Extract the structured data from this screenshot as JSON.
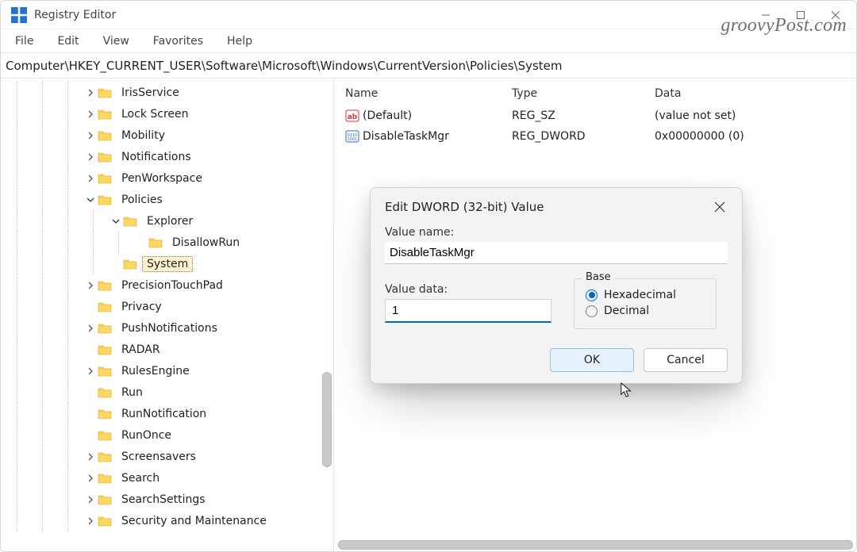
{
  "window": {
    "title": "Registry Editor"
  },
  "watermark": "groovyPost.com",
  "menu": [
    "File",
    "Edit",
    "View",
    "Favorites",
    "Help"
  ],
  "address": "Computer\\HKEY_CURRENT_USER\\Software\\Microsoft\\Windows\\CurrentVersion\\Policies\\System",
  "tree": [
    {
      "depth": 4,
      "exp": "closed",
      "label": "IrisService"
    },
    {
      "depth": 4,
      "exp": "closed",
      "label": "Lock Screen"
    },
    {
      "depth": 4,
      "exp": "closed",
      "label": "Mobility"
    },
    {
      "depth": 4,
      "exp": "closed",
      "label": "Notifications"
    },
    {
      "depth": 4,
      "exp": "closed",
      "label": "PenWorkspace"
    },
    {
      "depth": 4,
      "exp": "open",
      "label": "Policies"
    },
    {
      "depth": 5,
      "exp": "open",
      "label": "Explorer"
    },
    {
      "depth": 6,
      "exp": "none",
      "label": "DisallowRun"
    },
    {
      "depth": 5,
      "exp": "none",
      "label": "System",
      "selected": true
    },
    {
      "depth": 4,
      "exp": "closed",
      "label": "PrecisionTouchPad"
    },
    {
      "depth": 4,
      "exp": "none",
      "label": "Privacy"
    },
    {
      "depth": 4,
      "exp": "closed",
      "label": "PushNotifications"
    },
    {
      "depth": 4,
      "exp": "none",
      "label": "RADAR"
    },
    {
      "depth": 4,
      "exp": "closed",
      "label": "RulesEngine"
    },
    {
      "depth": 4,
      "exp": "none",
      "label": "Run"
    },
    {
      "depth": 4,
      "exp": "none",
      "label": "RunNotification"
    },
    {
      "depth": 4,
      "exp": "none",
      "label": "RunOnce"
    },
    {
      "depth": 4,
      "exp": "closed",
      "label": "Screensavers"
    },
    {
      "depth": 4,
      "exp": "closed",
      "label": "Search"
    },
    {
      "depth": 4,
      "exp": "closed",
      "label": "SearchSettings"
    },
    {
      "depth": 4,
      "exp": "closed",
      "label": "Security and Maintenance"
    }
  ],
  "list": {
    "headers": {
      "name": "Name",
      "type": "Type",
      "data": "Data"
    },
    "rows": [
      {
        "icon": "ab",
        "name": "(Default)",
        "type": "REG_SZ",
        "data": "(value not set)"
      },
      {
        "icon": "bin",
        "name": "DisableTaskMgr",
        "type": "REG_DWORD",
        "data": "0x00000000 (0)"
      }
    ]
  },
  "dialog": {
    "title": "Edit DWORD (32-bit) Value",
    "valueNameLabel": "Value name:",
    "valueName": "DisableTaskMgr",
    "valueDataLabel": "Value data:",
    "valueData": "1",
    "baseLabel": "Base",
    "hexLabel": "Hexadecimal",
    "decLabel": "Decimal",
    "ok": "OK",
    "cancel": "Cancel"
  }
}
